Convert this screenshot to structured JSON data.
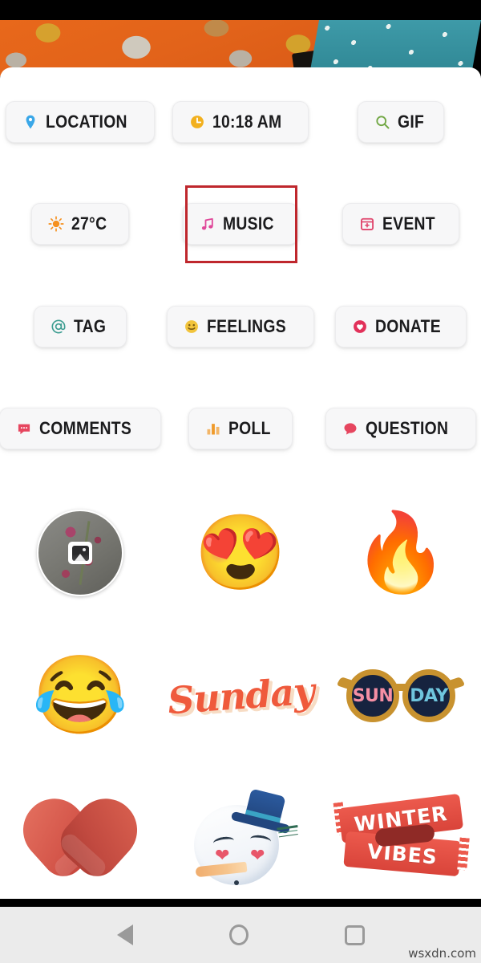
{
  "app": {
    "platform": "android",
    "screen_name": "post-attachment-sticker-picker"
  },
  "banner": {
    "description": "orange-buddha-fabric-photo",
    "colors": {
      "orange": "#e2631a",
      "teal": "#2f8794",
      "gold": "#d3a22c"
    }
  },
  "attachments": {
    "rows": [
      [
        {
          "icon": "location-pin-icon",
          "label": "LOCATION",
          "icon_color": "#3aa7e8"
        },
        {
          "icon": "clock-icon",
          "label": "10:18 AM",
          "icon_color": "#f2b01e"
        },
        {
          "icon": "search-icon",
          "label": "GIF",
          "icon_color": "#71a744"
        }
      ],
      [
        {
          "icon": "sun-icon",
          "label": "27°C",
          "icon_color": "#f5901f"
        },
        {
          "icon": "music-note-icon",
          "label": "MUSIC",
          "icon_color": "#e0499a"
        },
        {
          "icon": "calendar-icon",
          "label": "EVENT",
          "icon_color": "#e0446b"
        }
      ],
      [
        {
          "icon": "at-sign-icon",
          "label": "TAG",
          "icon_color": "#3f9e92"
        },
        {
          "icon": "smiley-icon",
          "label": "FEELINGS",
          "icon_color": "#f2c43c"
        },
        {
          "icon": "heart-hands-icon",
          "label": "DONATE",
          "icon_color": "#e2315a"
        }
      ],
      [
        {
          "icon": "comment-bubble-icon",
          "label": "COMMENTS",
          "icon_color": "#e6465f"
        },
        {
          "icon": "bar-chart-icon",
          "label": "POLL",
          "icon_color": "#ef9a2a"
        },
        {
          "icon": "question-bubble-icon",
          "label": "QUESTION",
          "icon_color": "#e6465f"
        }
      ]
    ]
  },
  "highlight": {
    "target_label": "MUSIC",
    "border_color": "#bf272d"
  },
  "stickers": {
    "rows": [
      [
        {
          "name": "photo-thumbnail-sticker",
          "kind": "photo",
          "label": ""
        },
        {
          "name": "smiling-heart-sticker",
          "kind": "emoji",
          "label": "😍"
        },
        {
          "name": "fire-sticker",
          "kind": "emoji",
          "label": "🔥"
        }
      ],
      [
        {
          "name": "tears-of-joy-sticker",
          "kind": "emoji",
          "label": "😂"
        },
        {
          "name": "sunday-script-sticker",
          "kind": "text",
          "label": "Sunday"
        },
        {
          "name": "sunday-sunglasses-sticker",
          "kind": "sunglasses",
          "label": "SUN DAY",
          "left_word": "SUN",
          "right_word": "DAY"
        }
      ],
      [
        {
          "name": "mitten-heart-sticker",
          "kind": "mittens",
          "label": ""
        },
        {
          "name": "snowman-sticker",
          "kind": "snowman",
          "label": ""
        },
        {
          "name": "winter-vibes-scarf-sticker",
          "kind": "scarf",
          "label": "WINTER VIBES",
          "line1": "WINTER",
          "line2": "VIBES"
        }
      ]
    ]
  },
  "navbar": {
    "back": "back-button",
    "home": "home-button",
    "recents": "recents-button"
  },
  "watermark": {
    "text": "wsxdn.com"
  }
}
